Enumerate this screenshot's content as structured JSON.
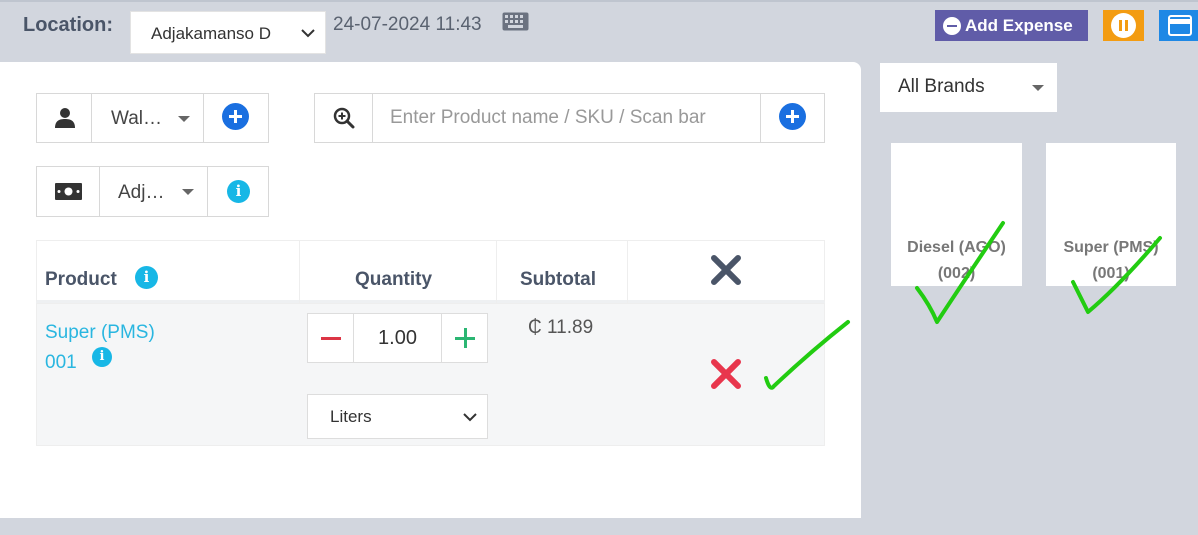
{
  "header": {
    "location_label": "Location:",
    "location_value": "Adjakamanso D",
    "datetime": "24-07-2024 11:43",
    "add_expense_label": "Add Expense"
  },
  "form": {
    "customer_value": "Wal…",
    "search_placeholder": "Enter Product name / SKU / Scan bar",
    "adjustment_value": "Adj…"
  },
  "table": {
    "headers": {
      "product": "Product",
      "quantity": "Quantity",
      "subtotal": "Subtotal"
    },
    "rows": [
      {
        "product_name": "Super (PMS)",
        "product_code": "001",
        "quantity": "1.00",
        "unit": "Liters",
        "subtotal": "₵ 11.89"
      }
    ]
  },
  "brands": {
    "selected": "All Brands",
    "products": [
      {
        "name": "Diesel (AGO)",
        "code": "(002)"
      },
      {
        "name": "Super (PMS)",
        "code": "(001)"
      }
    ]
  },
  "colors": {
    "background": "#d2d6de",
    "expense_button": "#605ca8",
    "pause_button": "#f39c12",
    "blue_button": "#1e88e5",
    "link_text": "#29b6e0",
    "remove_red": "#e8364d",
    "annotation_green": "#22cc11"
  },
  "icons": {
    "keyboard": "keyboard-icon",
    "user": "user-icon",
    "search": "search-plus-icon",
    "money": "money-bill-icon",
    "info": "info-circle-icon",
    "remove_all": "times-icon",
    "remove_row": "times-icon"
  }
}
